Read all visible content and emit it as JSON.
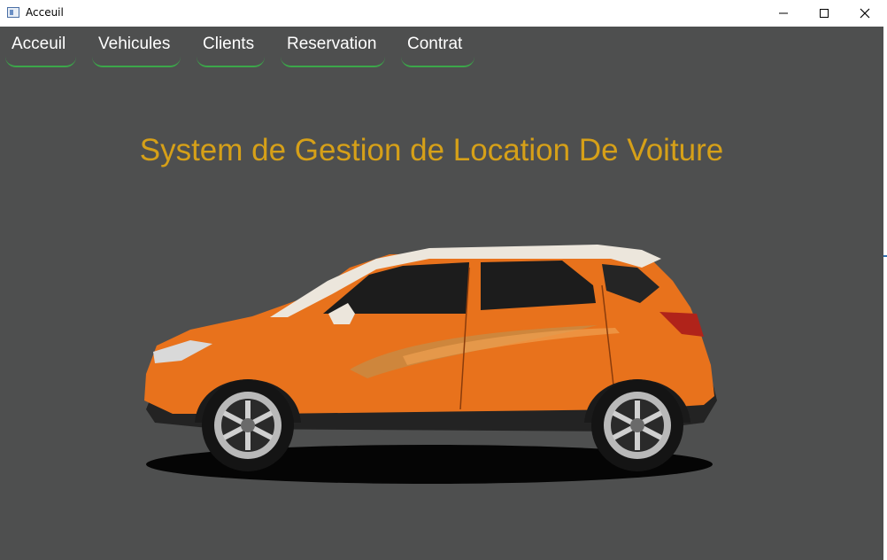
{
  "window": {
    "title": "Acceuil",
    "icons": [
      "app-icon",
      "minimize-icon",
      "maximize-icon",
      "close-icon"
    ]
  },
  "menu": {
    "items": [
      {
        "label": "Acceuil"
      },
      {
        "label": "Vehicules"
      },
      {
        "label": "Clients"
      },
      {
        "label": "Reservation"
      },
      {
        "label": "Contrat"
      }
    ]
  },
  "main": {
    "heading": "System de Gestion de Location De Voiture",
    "image": "orange-suv-car"
  },
  "colors": {
    "background": "#4e4f4f",
    "heading": "#d6a018",
    "menu_text": "#ffffff",
    "menu_underline": "#3ba74a",
    "car_body": "#e8721c",
    "car_roof": "#ece6dc"
  }
}
